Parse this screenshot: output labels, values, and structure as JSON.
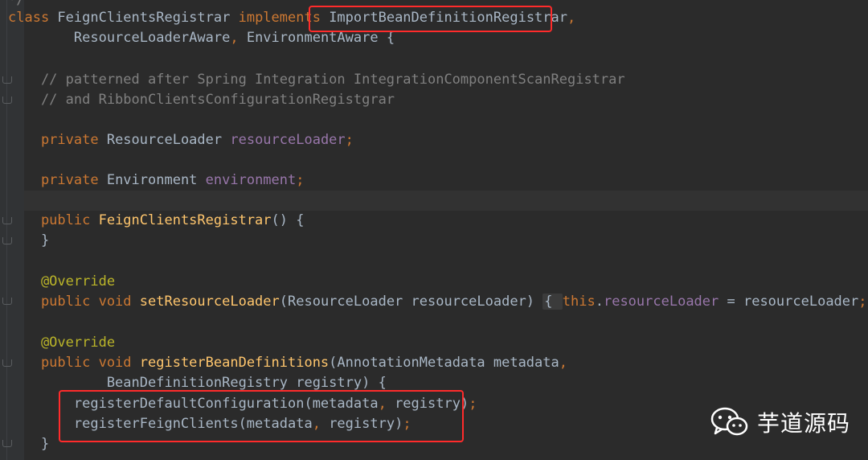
{
  "editor": {
    "lines": [
      {
        "id": "l0",
        "tokens": [
          {
            "t": "*/",
            "c": "cm"
          }
        ]
      },
      {
        "id": "l1",
        "tokens": [
          {
            "t": "class ",
            "c": "kw"
          },
          {
            "t": "FeignClientsRegistrar ",
            "c": ""
          },
          {
            "t": "implements ",
            "c": "kw"
          },
          {
            "t": "ImportBeanDefinitionRegistrar",
            "c": ""
          },
          {
            "t": ",",
            "c": "kw"
          }
        ]
      },
      {
        "id": "l2",
        "tokens": [
          {
            "t": "        ResourceLoaderAware",
            "c": ""
          },
          {
            "t": ", ",
            "c": "kw"
          },
          {
            "t": "EnvironmentAware {",
            "c": ""
          }
        ]
      },
      {
        "id": "l3",
        "tokens": []
      },
      {
        "id": "l4",
        "tokens": [
          {
            "t": "    // patterned after Spring Integration IntegrationComponentScanRegistrar",
            "c": "cm"
          }
        ]
      },
      {
        "id": "l5",
        "tokens": [
          {
            "t": "    // and RibbonClientsConfigurationRegistgrar",
            "c": "cm"
          }
        ]
      },
      {
        "id": "l6",
        "tokens": []
      },
      {
        "id": "l7",
        "tokens": [
          {
            "t": "    private ",
            "c": "kw"
          },
          {
            "t": "ResourceLoader ",
            "c": ""
          },
          {
            "t": "resourceLoader",
            "c": "fld"
          },
          {
            "t": ";",
            "c": "kw"
          }
        ]
      },
      {
        "id": "l8",
        "tokens": []
      },
      {
        "id": "l9",
        "tokens": [
          {
            "t": "    private ",
            "c": "kw"
          },
          {
            "t": "Environment ",
            "c": ""
          },
          {
            "t": "environment",
            "c": "fld"
          },
          {
            "t": ";",
            "c": "kw"
          }
        ]
      },
      {
        "id": "l10",
        "tokens": []
      },
      {
        "id": "l11",
        "tokens": [
          {
            "t": "    public ",
            "c": "kw"
          },
          {
            "t": "FeignClientsRegistrar",
            "c": "fn"
          },
          {
            "t": "() {",
            "c": ""
          }
        ]
      },
      {
        "id": "l12",
        "tokens": [
          {
            "t": "    }",
            "c": ""
          }
        ]
      },
      {
        "id": "l13",
        "tokens": []
      },
      {
        "id": "l14",
        "tokens": [
          {
            "t": "    @Override",
            "c": "ann"
          }
        ]
      },
      {
        "id": "l15",
        "tokens": [
          {
            "t": "    public void ",
            "c": "kw"
          },
          {
            "t": "setResourceLoader",
            "c": "fn"
          },
          {
            "t": "(ResourceLoader resourceLoader) ",
            "c": ""
          },
          {
            "t": "{ ",
            "c": "brace"
          },
          {
            "t": "this",
            "c": "kw"
          },
          {
            "t": ".",
            "c": ""
          },
          {
            "t": "resourceLoader",
            "c": "fld"
          },
          {
            "t": " = resourceLoader",
            "c": ""
          },
          {
            "t": "; ",
            "c": "kw"
          },
          {
            "t": "}",
            "c": "brace"
          }
        ]
      },
      {
        "id": "l16",
        "tokens": []
      },
      {
        "id": "l17",
        "tokens": [
          {
            "t": "    @Override",
            "c": "ann"
          }
        ]
      },
      {
        "id": "l18",
        "tokens": [
          {
            "t": "    public void ",
            "c": "kw"
          },
          {
            "t": "registerBeanDefinitions",
            "c": "fn"
          },
          {
            "t": "(AnnotationMetadata metadata",
            "c": ""
          },
          {
            "t": ",",
            "c": "kw"
          }
        ]
      },
      {
        "id": "l19",
        "tokens": [
          {
            "t": "            BeanDefinitionRegistry registry) {",
            "c": ""
          }
        ]
      },
      {
        "id": "l20",
        "tokens": [
          {
            "t": "        registerDefaultConfiguration(metadata",
            "c": ""
          },
          {
            "t": ", ",
            "c": "kw"
          },
          {
            "t": "registry)",
            "c": ""
          },
          {
            "t": ";",
            "c": "kw"
          }
        ]
      },
      {
        "id": "l21",
        "tokens": [
          {
            "t": "        registerFeignClients(metadata",
            "c": ""
          },
          {
            "t": ", ",
            "c": "kw"
          },
          {
            "t": "registry)",
            "c": ""
          },
          {
            "t": ";",
            "c": "kw"
          }
        ]
      },
      {
        "id": "l22",
        "tokens": [
          {
            "t": "    }",
            "c": ""
          }
        ]
      }
    ]
  },
  "watermark": {
    "icon": "wechat-icon",
    "text": "芋道源码"
  },
  "colors": {
    "highlight_box": "#ff2b2b",
    "background": "#2b2b2b",
    "keyword": "#cc7832",
    "comment": "#808080",
    "method": "#ffc66d",
    "field": "#9876aa",
    "annotation": "#bbb529",
    "text": "#a9b7c6"
  }
}
